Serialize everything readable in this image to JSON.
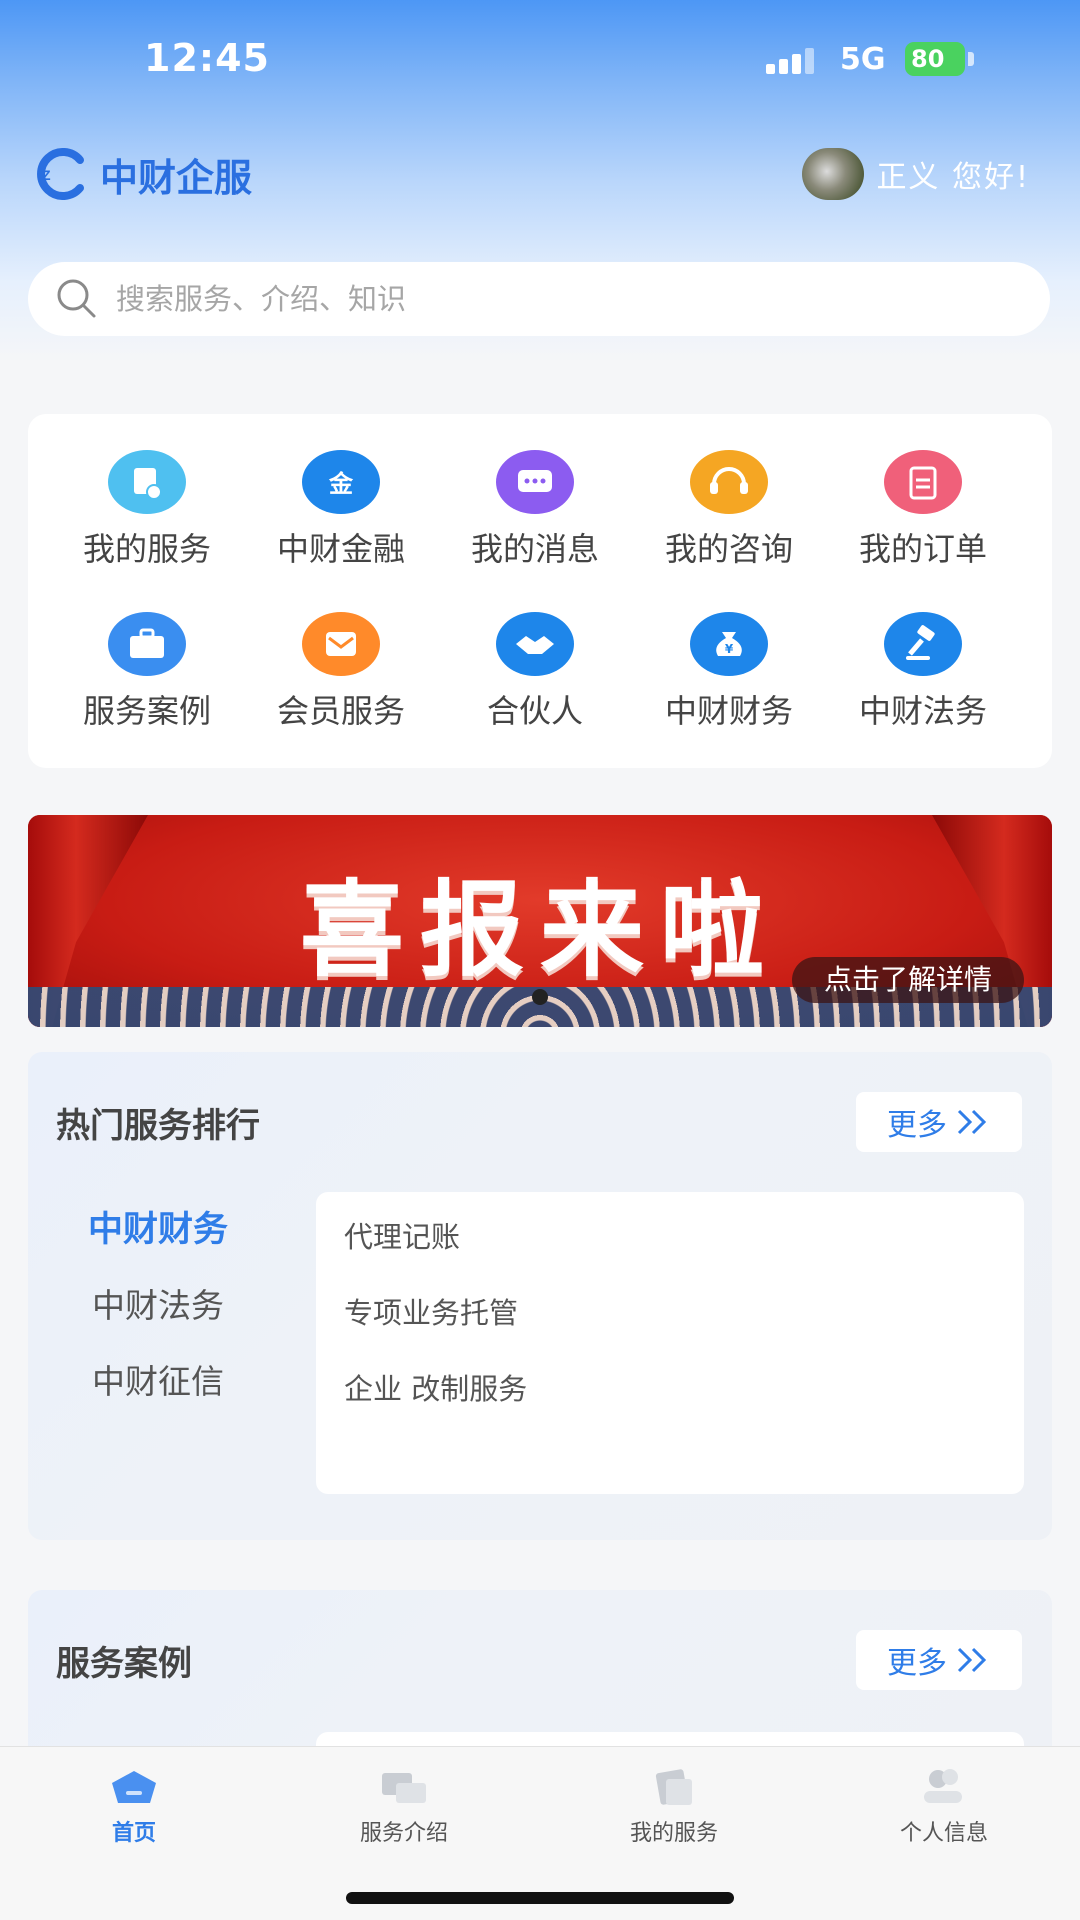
{
  "status_bar": {
    "time": "12:45",
    "network": "5G",
    "battery": "80"
  },
  "header": {
    "brand_name": "中财企服",
    "greeting": "正义 您好!"
  },
  "search": {
    "placeholder": "搜索服务、介绍、知识"
  },
  "menu": [
    {
      "label": "我的服务",
      "icon": "service-doc-icon",
      "color": "#4fc0f0"
    },
    {
      "label": "中财金融",
      "icon": "finance-gold-icon",
      "color": "#1e86ea"
    },
    {
      "label": "我的消息",
      "icon": "message-icon",
      "color": "#8c5cf0"
    },
    {
      "label": "我的咨询",
      "icon": "headset-icon",
      "color": "#f5a623"
    },
    {
      "label": "我的订单",
      "icon": "clipboard-icon",
      "color": "#f0607a"
    },
    {
      "label": "服务案例",
      "icon": "briefcase-icon",
      "color": "#3a8ef0"
    },
    {
      "label": "会员服务",
      "icon": "member-envelope-icon",
      "color": "#ff8a2a"
    },
    {
      "label": "合伙人",
      "icon": "handshake-icon",
      "color": "#1e86ea"
    },
    {
      "label": "中财财务",
      "icon": "money-bag-icon",
      "color": "#1e86ea"
    },
    {
      "label": "中财法务",
      "icon": "gavel-icon",
      "color": "#1e86ea"
    }
  ],
  "banner": {
    "title": "喜报来啦",
    "cta": "点击了解详情"
  },
  "hot_services": {
    "title": "热门服务排行",
    "more_label": "更多",
    "categories": [
      "中财财务",
      "中财法务",
      "中财征信"
    ],
    "active_category": "中财财务",
    "items": [
      "代理记账",
      "专项业务托管",
      "企业 改制服务"
    ]
  },
  "cases": {
    "title": "服务案例",
    "more_label": "更多"
  },
  "tabbar": [
    {
      "label": "首页",
      "icon": "home-icon",
      "active": true
    },
    {
      "label": "服务介绍",
      "icon": "service-intro-icon",
      "active": false
    },
    {
      "label": "我的服务",
      "icon": "my-service-icon",
      "active": false
    },
    {
      "label": "个人信息",
      "icon": "profile-icon",
      "active": false
    }
  ],
  "colors": {
    "accent": "#2f7de8",
    "brand": "#2a6fe0"
  }
}
